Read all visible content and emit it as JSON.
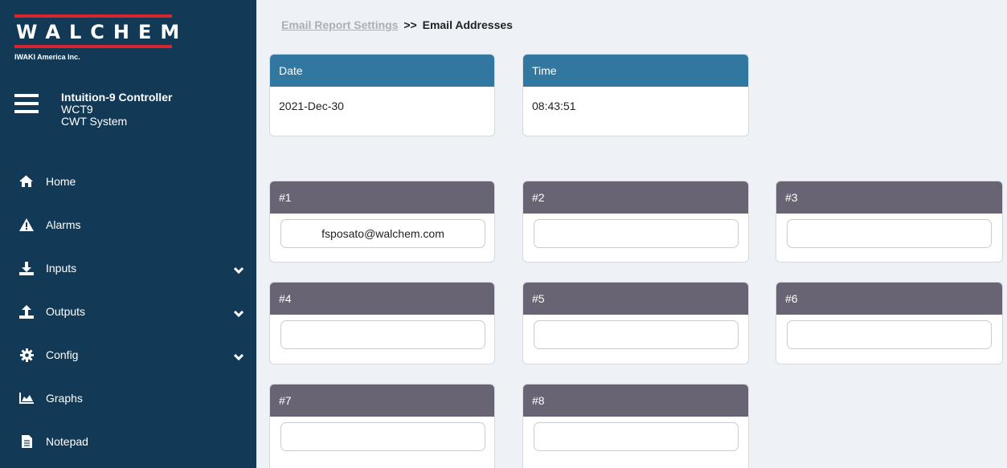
{
  "brand": {
    "logo_text": "WALCHEM",
    "sub": "IWAKI America Inc.",
    "accent_color": "#d7262e"
  },
  "device": {
    "name": "Intuition-9 Controller",
    "model": "WCT9",
    "system": "CWT System"
  },
  "nav": [
    {
      "label": "Home",
      "icon": "home-icon",
      "expandable": false
    },
    {
      "label": "Alarms",
      "icon": "alarm-warning-icon",
      "expandable": false
    },
    {
      "label": "Inputs",
      "icon": "download-icon",
      "expandable": true
    },
    {
      "label": "Outputs",
      "icon": "upload-icon",
      "expandable": true
    },
    {
      "label": "Config",
      "icon": "gear-icon",
      "expandable": true
    },
    {
      "label": "Graphs",
      "icon": "area-chart-icon",
      "expandable": false
    },
    {
      "label": "Notepad",
      "icon": "file-icon",
      "expandable": false
    }
  ],
  "breadcrumb": {
    "parent": "Email Report Settings",
    "separator": ">>",
    "current": "Email Addresses"
  },
  "date": {
    "label": "Date",
    "value": "2021-Dec-30"
  },
  "time": {
    "label": "Time",
    "value": "08:43:51"
  },
  "emails": [
    {
      "label": "#1",
      "value": "fsposato@walchem.com"
    },
    {
      "label": "#2",
      "value": ""
    },
    {
      "label": "#3",
      "value": ""
    },
    {
      "label": "#4",
      "value": ""
    },
    {
      "label": "#5",
      "value": ""
    },
    {
      "label": "#6",
      "value": ""
    },
    {
      "label": "#7",
      "value": ""
    },
    {
      "label": "#8",
      "value": ""
    }
  ],
  "colors": {
    "sidebar": "#123a57",
    "header_blue": "#3277a0",
    "header_gray": "#686473",
    "background": "#eef1f6"
  }
}
